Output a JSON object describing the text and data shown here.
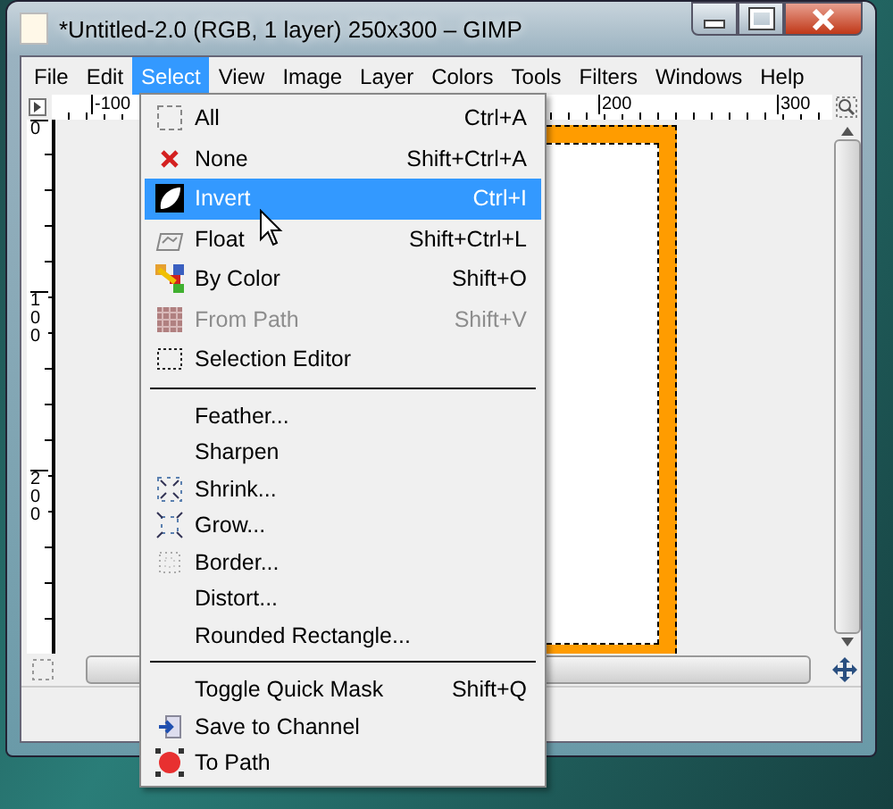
{
  "window": {
    "title": "*Untitled-2.0 (RGB, 1 layer) 250x300 – GIMP"
  },
  "menu_bar": [
    {
      "label": "File",
      "selected": false
    },
    {
      "label": "Edit",
      "selected": false
    },
    {
      "label": "Select",
      "selected": true
    },
    {
      "label": "View",
      "selected": false
    },
    {
      "label": "Image",
      "selected": false
    },
    {
      "label": "Layer",
      "selected": false
    },
    {
      "label": "Colors",
      "selected": false
    },
    {
      "label": "Tools",
      "selected": false
    },
    {
      "label": "Filters",
      "selected": false
    },
    {
      "label": "Windows",
      "selected": false
    },
    {
      "label": "Help",
      "selected": false
    }
  ],
  "rulers": {
    "horizontal": [
      "-100",
      "200",
      "300"
    ],
    "vertical": [
      "0",
      "100",
      "200"
    ]
  },
  "menu": {
    "items": [
      {
        "kind": "item",
        "label": "All",
        "shortcut": "Ctrl+A",
        "disabled": false,
        "selected": false
      },
      {
        "kind": "item",
        "label": "None",
        "shortcut": "Shift+Ctrl+A",
        "disabled": false,
        "selected": false
      },
      {
        "kind": "item",
        "label": "Invert",
        "shortcut": "Ctrl+I",
        "disabled": false,
        "selected": true
      },
      {
        "kind": "item",
        "label": "Float",
        "shortcut": "Shift+Ctrl+L",
        "disabled": false,
        "selected": false
      },
      {
        "kind": "item",
        "label": "By Color",
        "shortcut": "Shift+O",
        "disabled": false,
        "selected": false
      },
      {
        "kind": "item",
        "label": "From Path",
        "shortcut": "Shift+V",
        "disabled": true,
        "selected": false
      },
      {
        "kind": "item",
        "label": "Selection Editor",
        "disabled": false,
        "selected": false
      },
      {
        "kind": "separator"
      },
      {
        "kind": "item",
        "label": "Feather...",
        "disabled": false,
        "selected": false
      },
      {
        "kind": "item",
        "label": "Sharpen",
        "disabled": false,
        "selected": false
      },
      {
        "kind": "item",
        "label": "Shrink...",
        "disabled": false,
        "selected": false
      },
      {
        "kind": "item",
        "label": "Grow...",
        "disabled": false,
        "selected": false
      },
      {
        "kind": "item",
        "label": "Border...",
        "disabled": false,
        "selected": false
      },
      {
        "kind": "item",
        "label": "Distort...",
        "disabled": false,
        "selected": false
      },
      {
        "kind": "item",
        "label": "Rounded Rectangle...",
        "disabled": false,
        "selected": false
      },
      {
        "kind": "separator"
      },
      {
        "kind": "item",
        "label": "Toggle Quick Mask",
        "shortcut": "Shift+Q",
        "disabled": false,
        "selected": false
      },
      {
        "kind": "item",
        "label": "Save to Channel",
        "disabled": false,
        "selected": false
      },
      {
        "kind": "item",
        "label": "To Path",
        "disabled": false,
        "selected": false
      }
    ]
  }
}
